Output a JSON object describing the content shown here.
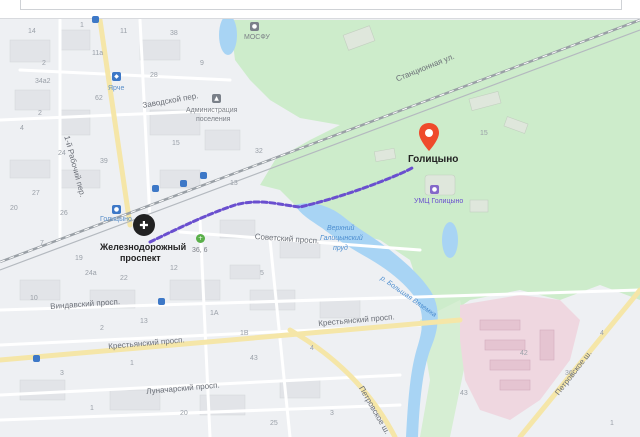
{
  "map": {
    "destination_label": "Голицыно",
    "start_label_line1": "Железнодорожный",
    "start_label_line2": "проспект",
    "pond_label_line1": "Верхний",
    "pond_label_line2": "Галицынский",
    "pond_label_line3": "пруд",
    "river_label": "р. Большая Вяземка",
    "poi": {
      "mosfu": "МОСФУ",
      "yarche": "Ярче",
      "admin_line1": "Администрация",
      "admin_line2": "поселения",
      "golitsyno_poi": "Голицыно",
      "umts": "УМЦ Голицыно",
      "bus_stop": "36, 6"
    },
    "streets": {
      "stantsionnaya": "Станционная ул.",
      "zavodskoy": "Заводской пер.",
      "rabochiy": "1-й Рабочий пер.",
      "sovetskiy": "Советский просп.",
      "vindavskiy": "Виндавский просп.",
      "krestyanskiy1": "Крестьянский просп.",
      "krestyanskiy2": "Крестьянский просп.",
      "lunacharskiy": "Луначарский просп.",
      "petrovskoe": "Петровское ш.",
      "petrovskoe2": "Петровское ш."
    },
    "house_numbers": [
      "14",
      "1",
      "11",
      "38",
      "2",
      "11а",
      "34а2",
      "28",
      "62",
      "4",
      "24",
      "39",
      "27",
      "9",
      "15",
      "20",
      "26",
      "7",
      "19",
      "24а",
      "22",
      "10",
      "12",
      "5",
      "1А",
      "2",
      "13",
      "1В",
      "3",
      "4",
      "1",
      "43",
      "1",
      "20",
      "25",
      "3",
      "43",
      "42",
      "4",
      "1",
      "13",
      "32",
      "36",
      "15",
      "2"
    ],
    "colors": {
      "forest": "#cdeccb",
      "urban": "#eef0f3",
      "industrial": "#efd7e0",
      "water": "#a8d4f4",
      "road_major": "#f5e6a8",
      "route": "#6a4fcf",
      "pin": "#ef4a2c",
      "rail": "#9aa0a6"
    }
  }
}
